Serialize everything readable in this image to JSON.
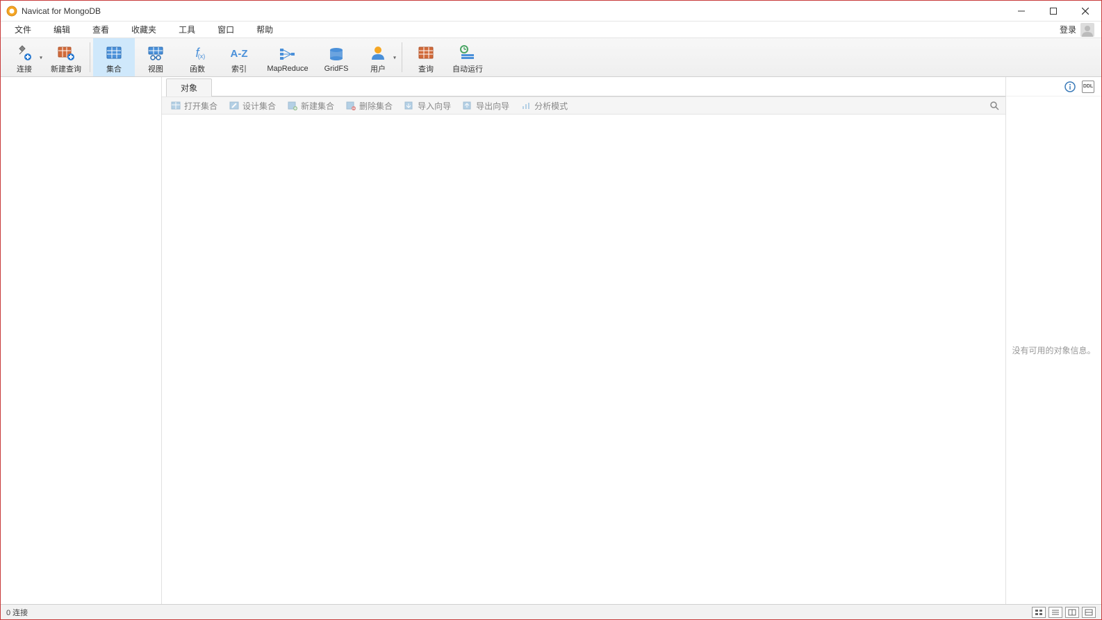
{
  "window": {
    "title": "Navicat for MongoDB"
  },
  "menubar": {
    "items": [
      "文件",
      "编辑",
      "查看",
      "收藏夹",
      "工具",
      "窗口",
      "帮助"
    ],
    "login": "登录"
  },
  "toolbar": {
    "connect": "连接",
    "new_query": "新建查询",
    "collection": "集合",
    "view": "视图",
    "function": "函数",
    "index": "索引",
    "mapreduce": "MapReduce",
    "gridfs": "GridFS",
    "user": "用户",
    "query": "查询",
    "autorun": "自动运行"
  },
  "tabs": {
    "object": "对象"
  },
  "subtoolbar": {
    "open": "打开集合",
    "design": "设计集合",
    "new": "新建集合",
    "delete": "删除集合",
    "import": "导入向导",
    "export": "导出向导",
    "analyze": "分析模式"
  },
  "rightpanel": {
    "empty": "没有可用的对象信息。"
  },
  "statusbar": {
    "connections": "0 连接"
  }
}
